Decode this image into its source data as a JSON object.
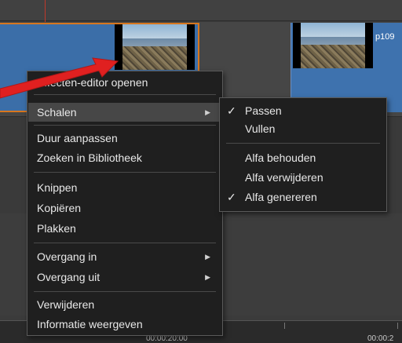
{
  "timeline": {
    "clip2_title": "p109",
    "time_left": "00:00:20:00",
    "time_right": "00:00:2"
  },
  "context_menu": {
    "items": [
      {
        "label": "Effecten-editor openen"
      },
      {
        "label": "Schalen",
        "has_submenu": true,
        "highlighted": true
      },
      {
        "label": "Duur aanpassen"
      },
      {
        "label": "Zoeken in Bibliotheek"
      },
      {
        "label": "Knippen"
      },
      {
        "label": "Kopiëren"
      },
      {
        "label": "Plakken"
      },
      {
        "label": "Overgang in",
        "has_submenu": true
      },
      {
        "label": "Overgang uit",
        "has_submenu": true
      },
      {
        "label": "Verwijderen"
      },
      {
        "label": "Informatie weergeven"
      }
    ]
  },
  "submenu": {
    "items": [
      {
        "label": "Passen",
        "checked": true
      },
      {
        "label": "Vullen",
        "checked": false
      },
      {
        "label": "Alfa behouden",
        "checked": false
      },
      {
        "label": "Alfa verwijderen",
        "checked": false
      },
      {
        "label": "Alfa genereren",
        "checked": true
      }
    ]
  },
  "icons": {
    "submenu_arrow": "chevron-right-icon",
    "check": "checkmark-icon",
    "callout": "red-arrow"
  },
  "colors": {
    "clip_blue": "#3b6ea8",
    "clip_selected_border": "#d7761e",
    "menu_bg": "#1f1f1f",
    "menu_highlight": "#474747",
    "callout_red": "#e02020"
  }
}
